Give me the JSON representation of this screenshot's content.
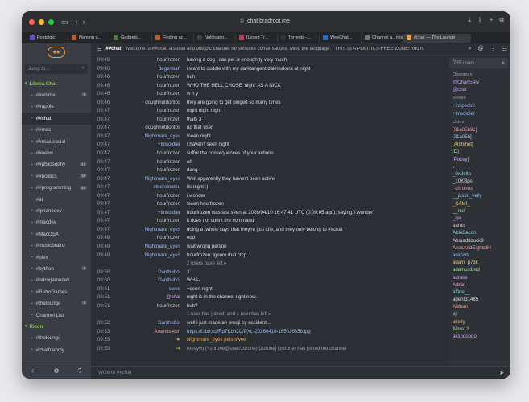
{
  "browser": {
    "url": "chat.bradroot.me",
    "tabs": [
      {
        "label": "Postalgic",
        "color": "#6a4bd1"
      },
      {
        "label": "Naming a...",
        "color": "#c2592a"
      },
      {
        "label": "Gadgets...",
        "color": "#4a7c3f"
      },
      {
        "label": "Finding ac...",
        "color": "#c2592a"
      },
      {
        "label": "Notificatio...",
        "color": "#444"
      },
      {
        "label": "[Loved Tr...",
        "color": "#c23b5c"
      },
      {
        "label": "Torrents -...",
        "color": "#333"
      },
      {
        "label": "WeeChat...",
        "color": "#2a6ac2"
      },
      {
        "label": "Channel a...nfigura...",
        "color": "#777"
      },
      {
        "label": "#chat — The Lounge",
        "color": "#e9a23b"
      }
    ]
  },
  "sidebar": {
    "logo": "THE LOUNGE",
    "jump_placeholder": "Jump to...",
    "footer_icons": [
      "plus-icon",
      "gear-icon",
      "help-icon"
    ],
    "items": [
      {
        "kind": "net",
        "label": "Libera.Chat"
      },
      {
        "kind": "chan",
        "label": "##anime",
        "badge": "8"
      },
      {
        "kind": "chan",
        "label": "##apple",
        "badge": ""
      },
      {
        "kind": "chan",
        "label": "##chat",
        "badge": "",
        "active": true
      },
      {
        "kind": "chan",
        "label": "##mac",
        "badge": ""
      },
      {
        "kind": "chan",
        "label": "##mac-social",
        "badge": ""
      },
      {
        "kind": "chan",
        "label": "##news",
        "badge": ""
      },
      {
        "kind": "chan",
        "label": "##philosophy",
        "badge": "12"
      },
      {
        "kind": "chan",
        "label": "##politics",
        "badge": "18"
      },
      {
        "kind": "chan",
        "label": "##programming",
        "badge": "10"
      },
      {
        "kind": "chan",
        "label": "#ai",
        "badge": ""
      },
      {
        "kind": "chan",
        "label": "#iphonedev",
        "badge": ""
      },
      {
        "kind": "chan",
        "label": "#macdev",
        "badge": ""
      },
      {
        "kind": "chan",
        "label": "#MacOSX",
        "badge": ""
      },
      {
        "kind": "chan",
        "label": "#musicbrainz",
        "badge": ""
      },
      {
        "kind": "chan",
        "label": "#plex",
        "badge": ""
      },
      {
        "kind": "chan",
        "label": "#python",
        "badge": "9"
      },
      {
        "kind": "chan",
        "label": "#retrogamedev",
        "badge": ""
      },
      {
        "kind": "chan",
        "label": "#RetroGames",
        "badge": ""
      },
      {
        "kind": "chan",
        "label": "#thelounge",
        "badge": "5"
      },
      {
        "kind": "chan",
        "label": "Channel List",
        "badge": ""
      },
      {
        "kind": "net",
        "label": "Rizon"
      },
      {
        "kind": "chan",
        "label": "#thelounge",
        "badge": ""
      },
      {
        "kind": "chan",
        "label": "#chatfriendly",
        "badge": ""
      }
    ]
  },
  "channel": {
    "name": "##chat",
    "topic": "Welcome to ##chat, a social and offtopic channel for sensible conversations. Mind the language. | THIS IS A POLITICS-FREE ZONE! You have been w"
  },
  "messages": [
    {
      "t": "09:46",
      "n": "hourfrozen",
      "x": "having a dog i can pet is enough ty very much"
    },
    {
      "t": "09:46",
      "n": "degenoah",
      "x": "i want to cuddle with my darktangent dakimakura at night"
    },
    {
      "t": "09:46",
      "n": "hourfrozen",
      "x": "huh"
    },
    {
      "t": "09:46",
      "n": "hourfrozen",
      "x": "WHO THE HELL CHOSE 'night' AS A NICK"
    },
    {
      "t": "09:46",
      "n": "hourfrozen",
      "x": "w h y"
    },
    {
      "t": "09:46",
      "n": "doughnutdoritos",
      "x": "they are going to get pinged so many times"
    },
    {
      "t": "09:47",
      "n": "hourfrozen",
      "x": "night night night"
    },
    {
      "t": "09:47",
      "n": "hourfrozen",
      "x": "thats 3"
    },
    {
      "t": "09:47",
      "n": "doughnutdoritos",
      "x": "rip that user"
    },
    {
      "t": "09:47",
      "n": "Nightmare_eyes",
      "x": "!seen night"
    },
    {
      "t": "09:47",
      "n": "+tinsoldier",
      "x": "I haven't seen night"
    },
    {
      "t": "09:47",
      "n": "hourfrozen",
      "x": "suffer the consequences of your actions"
    },
    {
      "t": "09:47",
      "n": "hourfrozen",
      "x": "oh"
    },
    {
      "t": "09:47",
      "n": "hourfrozen",
      "x": "dang"
    },
    {
      "t": "09:47",
      "n": "Nightmare_eyes",
      "x": "Well apparently they haven't been active"
    },
    {
      "t": "09:47",
      "n": "stnerolnamu",
      "x": "its night :)"
    },
    {
      "t": "09:47",
      "n": "hourfrozen",
      "x": "i wonder"
    },
    {
      "t": "09:47",
      "n": "hourfrozen",
      "x": "!seen hourfrozen"
    },
    {
      "t": "09:47",
      "n": "+tinsoldier",
      "x": "hourfrozen was last seen at 2026/04/10 16:47:41 UTC (0:00:05 ago), saying 'i wonder'"
    },
    {
      "t": "09:47",
      "n": "hourfrozen",
      "x": "it does not count the command"
    },
    {
      "t": "09:47",
      "n": "Nightmare_eyes",
      "x": "doing a /whois says that they're just idle, and they only belong to ##chat"
    },
    {
      "t": "09:48",
      "n": "hourfrozen",
      "x": "odd"
    },
    {
      "t": "09:48",
      "n": "Nightmare_eyes",
      "x": "wait wrong person"
    },
    {
      "t": "09:48",
      "n": "Nightmare_eyes",
      "x": "hourfrozen: ignore that ctcp"
    },
    {
      "t": "",
      "n": "",
      "x": "2 users have left ▸",
      "sys": true
    },
    {
      "t": "09:50",
      "n": "Danthebol",
      "x": ":/"
    },
    {
      "t": "09:50",
      "n": "Danthebol",
      "x": "WHA-"
    },
    {
      "t": "09:51",
      "n": "swee",
      "x": "+seen night"
    },
    {
      "t": "09:51",
      "n": "@chat",
      "x": "night is in the channel right now."
    },
    {
      "t": "09:51",
      "n": "hourfrozen",
      "x": "huh?"
    },
    {
      "t": "",
      "n": "",
      "x": "1 user has joined, and 1 user has left ▸",
      "sys": true
    },
    {
      "t": "09:52",
      "n": "Danthebol",
      "x": "well i just made an emoji by accident..."
    },
    {
      "t": "09:53",
      "n": "Artemis-kun",
      "x": "https://i.ibb.co/Rp7Kbh2C/PXL-20260410-165026358.jpg"
    },
    {
      "t": "09:53",
      "n": "★",
      "x": "Nightmare_eyes pets swee",
      "hl": true
    },
    {
      "t": "09:53",
      "n": "➜",
      "x": "roesyyu (~zorone@user/zorone) [zorone] (zorone) has joined the channel",
      "sys": true
    }
  ],
  "userlist": {
    "count_label": "785 users",
    "groups": [
      {
        "title": "Operators",
        "users": [
          "@ChanServ",
          "@chat"
        ],
        "color": "#c9a0f0"
      },
      {
        "title": "Voiced",
        "users": [
          "+inspector",
          "+tinsoldier"
        ],
        "color": "#8fb8f0"
      },
      {
        "title": "Users",
        "users": [
          "[31a05b9c]",
          "[31a05b]",
          "[Archinet]",
          "[D]",
          "[Pokey]",
          "\\",
          "_0xdelta",
          "_10KBps",
          "_chronos",
          "__justin_kelly",
          "_KAMI_",
          "__null",
          "_qw",
          "aardo",
          "AbleBacon",
          "Absurditduck9",
          "AcesAndEights84",
          "acidsys",
          "adam_p73k",
          "adamus1red",
          "adrake",
          "Adran",
          "affine__",
          "agent31485",
          "Aidhan",
          "ajr",
          "akelly",
          "Akira12",
          "akspooooo"
        ]
      }
    ]
  },
  "input": {
    "placeholder": "Write to ##chat"
  },
  "colors": {
    "accent": "#e9a23b",
    "network": "#8bc34a"
  }
}
